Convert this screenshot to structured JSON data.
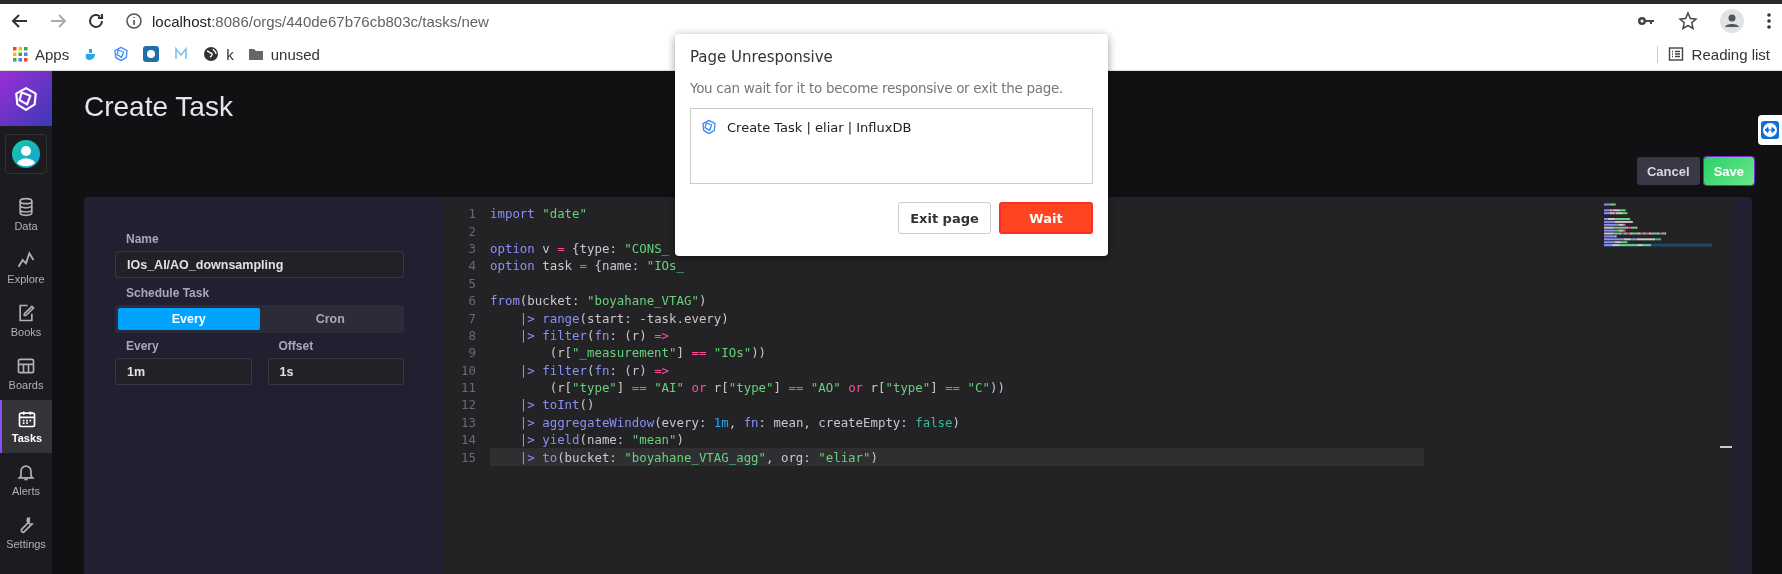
{
  "browser": {
    "url_host": "localhost",
    "url_path": ":8086/orgs/440de67b76cb803c/tasks/new",
    "bookmarks": [
      {
        "kind": "apps",
        "label": "Apps"
      },
      {
        "kind": "docker"
      },
      {
        "kind": "influx"
      },
      {
        "kind": "pg"
      },
      {
        "kind": "mail"
      },
      {
        "kind": "globe",
        "label": "k"
      },
      {
        "kind": "folder",
        "label": "unused"
      }
    ],
    "reading_list": "Reading list"
  },
  "sidebar": {
    "items": [
      {
        "kind": "data",
        "label": "Data",
        "selected": false
      },
      {
        "kind": "explore",
        "label": "Explore",
        "selected": false
      },
      {
        "kind": "books",
        "label": "Books",
        "selected": false
      },
      {
        "kind": "boards",
        "label": "Boards",
        "selected": false
      },
      {
        "kind": "tasks",
        "label": "Tasks",
        "selected": true
      },
      {
        "kind": "alerts",
        "label": "Alerts",
        "selected": false
      },
      {
        "kind": "settings",
        "label": "Settings",
        "selected": false
      }
    ]
  },
  "page": {
    "title": "Create Task",
    "buttons": [
      {
        "kind": "cancel",
        "label": "Cancel"
      },
      {
        "kind": "save",
        "label": "Save"
      }
    ]
  },
  "form": {
    "name_label": "Name",
    "name_value": "IOs_AI/AO_downsampling",
    "schedule_label": "Schedule Task",
    "schedule_options": [
      {
        "label": "Every",
        "selected": true
      },
      {
        "label": "Cron",
        "selected": false
      }
    ],
    "every_label": "Every",
    "every_value": "1m",
    "offset_label": "Offset",
    "offset_value": "1s"
  },
  "editor": {
    "lines": [
      {
        "number": "1",
        "current": false,
        "tokens": [
          {
            "kind": "kw",
            "text": "import"
          },
          {
            "kind": "str",
            "text": " \"date\""
          }
        ]
      },
      {
        "number": "2",
        "current": false
      },
      {
        "number": "3",
        "current": false,
        "tokens": [
          {
            "kind": "kw",
            "text": "option"
          },
          {
            "kind": "plain",
            "text": " v "
          },
          {
            "kind": "op",
            "text": "="
          },
          {
            "kind": "plain",
            "text": " {type: "
          },
          {
            "kind": "str",
            "text": "\"CONS_"
          }
        ]
      },
      {
        "number": "4",
        "current": false,
        "tokens": [
          {
            "kind": "kw",
            "text": "option"
          },
          {
            "kind": "plain",
            "text": " task "
          },
          {
            "kind": "op",
            "text": "="
          },
          {
            "kind": "plain",
            "text": " {name: "
          },
          {
            "kind": "str",
            "text": "\"IOs_"
          }
        ]
      },
      {
        "number": "5",
        "current": false
      },
      {
        "number": "6",
        "current": false,
        "tokens": [
          {
            "kind": "kw",
            "text": "from"
          },
          {
            "kind": "plain",
            "text": "(bucket: "
          },
          {
            "kind": "str",
            "text": "\"boyahane_VTAG\""
          },
          {
            "kind": "plain",
            "text": ")"
          }
        ]
      },
      {
        "number": "7",
        "current": false,
        "tokens": [
          {
            "kind": "kw",
            "text": "    |> range"
          },
          {
            "kind": "plain",
            "text": "(start: -task.every)"
          }
        ]
      },
      {
        "number": "8",
        "current": false,
        "tokens": [
          {
            "kind": "kw",
            "text": "    |> filter"
          },
          {
            "kind": "plain",
            "text": "("
          },
          {
            "kind": "kw",
            "text": "fn"
          },
          {
            "kind": "plain",
            "text": ": (r) "
          },
          {
            "kind": "op",
            "text": "=>"
          }
        ]
      },
      {
        "number": "9",
        "current": false,
        "tokens": [
          {
            "kind": "plain",
            "text": "        (r["
          },
          {
            "kind": "str",
            "text": "\"_measurement\""
          },
          {
            "kind": "plain",
            "text": "] "
          },
          {
            "kind": "op",
            "text": "== "
          },
          {
            "kind": "str",
            "text": "\"IOs\""
          },
          {
            "kind": "plain",
            "text": "))"
          }
        ]
      },
      {
        "number": "10",
        "current": false,
        "tokens": [
          {
            "kind": "kw",
            "text": "    |> filter"
          },
          {
            "kind": "plain",
            "text": "("
          },
          {
            "kind": "kw",
            "text": "fn"
          },
          {
            "kind": "plain",
            "text": ": (r) "
          },
          {
            "kind": "op",
            "text": "=>"
          }
        ]
      },
      {
        "number": "11",
        "current": false,
        "tokens": [
          {
            "kind": "plain",
            "text": "        (r["
          },
          {
            "kind": "str",
            "text": "\"type\""
          },
          {
            "kind": "plain",
            "text": "] "
          },
          {
            "kind": "op",
            "text": "== "
          },
          {
            "kind": "str",
            "text": "\"AI\""
          },
          {
            "kind": "op",
            "text": " or"
          },
          {
            "kind": "plain",
            "text": " r["
          },
          {
            "kind": "str",
            "text": "\"type\""
          },
          {
            "kind": "plain",
            "text": "] "
          },
          {
            "kind": "op",
            "text": "== "
          },
          {
            "kind": "str",
            "text": "\"AO\""
          },
          {
            "kind": "op",
            "text": " or"
          },
          {
            "kind": "plain",
            "text": " r["
          },
          {
            "kind": "str",
            "text": "\"type\""
          },
          {
            "kind": "plain",
            "text": "] "
          },
          {
            "kind": "op",
            "text": "== "
          },
          {
            "kind": "str",
            "text": "\"C\""
          },
          {
            "kind": "plain",
            "text": "))"
          }
        ]
      },
      {
        "number": "12",
        "current": false,
        "tokens": [
          {
            "kind": "kw",
            "text": "    |> toInt"
          },
          {
            "kind": "plain",
            "text": "()"
          }
        ]
      },
      {
        "number": "13",
        "current": false,
        "tokens": [
          {
            "kind": "kw",
            "text": "    |> aggregateWindow"
          },
          {
            "kind": "plain",
            "text": "(every: "
          },
          {
            "kind": "num",
            "text": "1m"
          },
          {
            "kind": "plain",
            "text": ", "
          },
          {
            "kind": "kw",
            "text": "fn"
          },
          {
            "kind": "plain",
            "text": ": mean, createEmpty: "
          },
          {
            "kind": "bool",
            "text": "false"
          },
          {
            "kind": "plain",
            "text": ")"
          }
        ]
      },
      {
        "number": "14",
        "current": false,
        "tokens": [
          {
            "kind": "kw",
            "text": "    |> yield"
          },
          {
            "kind": "plain",
            "text": "(name: "
          },
          {
            "kind": "str",
            "text": "\"mean\""
          },
          {
            "kind": "plain",
            "text": ")"
          }
        ]
      },
      {
        "number": "15",
        "current": true,
        "tokens": [
          {
            "kind": "kw",
            "text": "    |> to"
          },
          {
            "kind": "plain",
            "text": "(bucket: "
          },
          {
            "kind": "str",
            "text": "\"boyahane_VTAG_agg\""
          },
          {
            "kind": "plain",
            "text": ", org: "
          },
          {
            "kind": "str",
            "text": "\"eliar\""
          },
          {
            "kind": "plain",
            "text": ")"
          }
        ]
      }
    ]
  },
  "dialog": {
    "title": "Page Unresponsive",
    "message": "You can wait for it to become responsive or exit the page.",
    "pages": [
      {
        "title": "Create Task | eliar | InfluxDB"
      }
    ],
    "buttons": [
      {
        "kind": "secondary",
        "label": "Exit page"
      },
      {
        "kind": "primary",
        "label": "Wait"
      }
    ]
  }
}
